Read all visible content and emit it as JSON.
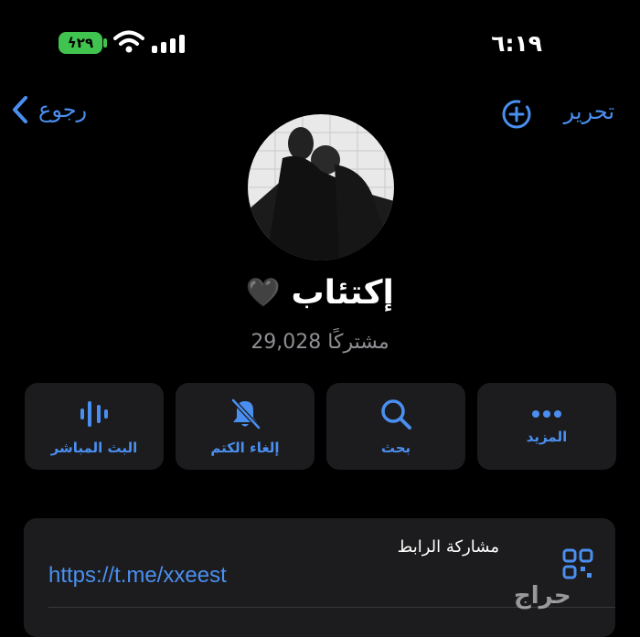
{
  "status_bar": {
    "time": "٦:١٩",
    "battery": "ϟ٢٩"
  },
  "nav": {
    "back_label": "رجوع",
    "edit_label": "تحرير"
  },
  "profile": {
    "title": "إكتئاب",
    "heart": "🖤",
    "subscribers": "29,028 مشتركًا"
  },
  "actions": [
    {
      "label": "المزيد",
      "icon": "more-icon"
    },
    {
      "label": "بحث",
      "icon": "search-icon"
    },
    {
      "label": "إلغاء الكتم",
      "icon": "bell-slash-icon"
    },
    {
      "label": "البث المباشر",
      "icon": "live-stream-icon"
    }
  ],
  "link_card": {
    "title": "مشاركة الرابط",
    "url": "https://t.me/xxeest"
  },
  "watermark": "حراج",
  "colors": {
    "accent": "#4a8ff0",
    "card_bg": "#1c1c1e",
    "battery_green": "#41c34f"
  }
}
